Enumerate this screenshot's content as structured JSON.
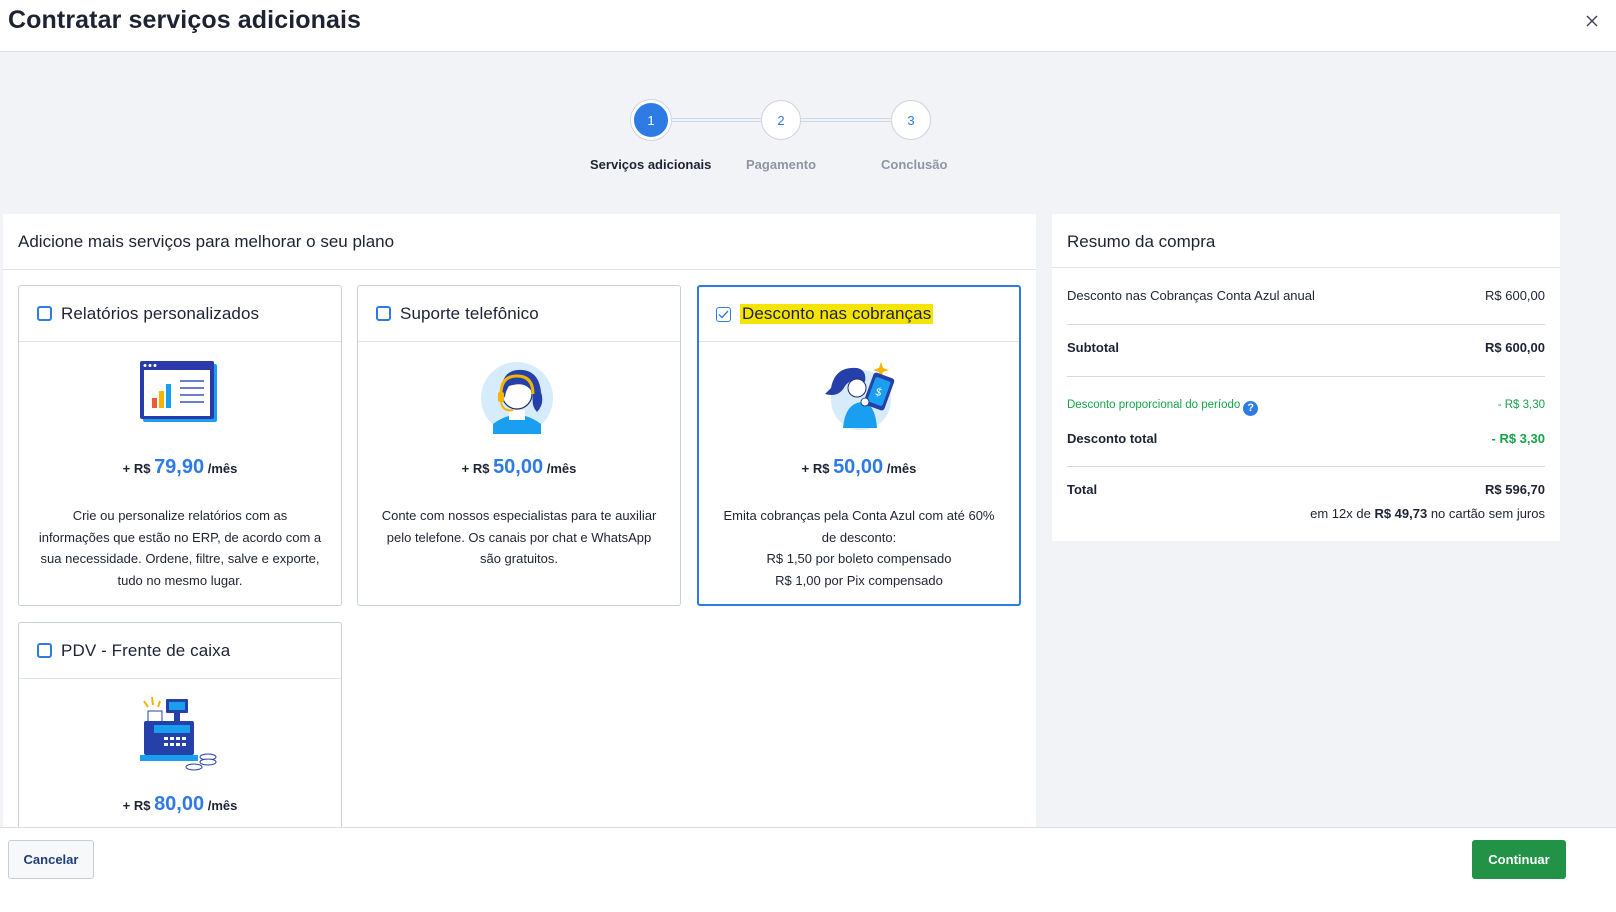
{
  "header": {
    "title": "Contratar serviços adicionais",
    "close_icon": "close-icon"
  },
  "stepper": {
    "current": 1,
    "steps": [
      {
        "number": "1",
        "label": "Serviços adicionais"
      },
      {
        "number": "2",
        "label": "Pagamento"
      },
      {
        "number": "3",
        "label": "Conclusão"
      }
    ]
  },
  "main": {
    "heading": "Adicione mais serviços para melhorar o seu plano",
    "cards": [
      {
        "title": "Relatórios personalizados",
        "checked": false,
        "illustration": "report-chart-illustration",
        "price_prefix": "+ R$",
        "price": "79,90",
        "price_suffix": "/mês",
        "description": "Crie ou personalize relatórios com as informações que estão no ERP, de acordo com a sua necessidade. Ordene, filtre, salve e exporte, tudo no mesmo lugar."
      },
      {
        "title": "Suporte telefônico",
        "checked": false,
        "illustration": "headset-agent-illustration",
        "price_prefix": "+ R$",
        "price": "50,00",
        "price_suffix": "/mês",
        "description": "Conte com nossos especialistas para te auxiliar pelo telefone. Os canais por chat e WhatsApp são gratuitos."
      },
      {
        "title": "Desconto nas cobranças",
        "checked": true,
        "illustration": "woman-with-bill-illustration",
        "price_prefix": "+ R$",
        "price": "50,00",
        "price_suffix": "/mês",
        "description_lines": [
          "Emita cobranças pela Conta Azul com até 60%",
          "de desconto:",
          "R$ 1,50 por boleto compensado",
          "R$ 1,00 por Pix compensado"
        ]
      },
      {
        "title": "PDV - Frente de caixa",
        "checked": false,
        "illustration": "cash-register-illustration",
        "price_prefix": "+ R$",
        "price": "80,00",
        "price_suffix": "/mês"
      }
    ]
  },
  "summary": {
    "heading": "Resumo da compra",
    "item_label": "Desconto nas Cobranças Conta Azul anual",
    "item_value": "R$ 600,00",
    "subtotal_label": "Subtotal",
    "subtotal_value": "R$ 600,00",
    "prop_discount_label": "Desconto proporcional do período",
    "prop_discount_value": "- R$ 3,30",
    "total_discount_label": "Desconto total",
    "total_discount_value": "- R$ 3,30",
    "total_label": "Total",
    "total_value": "R$ 596,70",
    "installments_prefix": "em 12x de",
    "installments_value": "R$ 49,73",
    "installments_suffix": "no cartão sem juros"
  },
  "footer": {
    "cancel_label": "Cancelar",
    "continue_label": "Continuar"
  },
  "colors": {
    "accent": "#2f7be6",
    "success": "#229247",
    "highlight": "#f5e400",
    "discount": "#17a34a"
  }
}
